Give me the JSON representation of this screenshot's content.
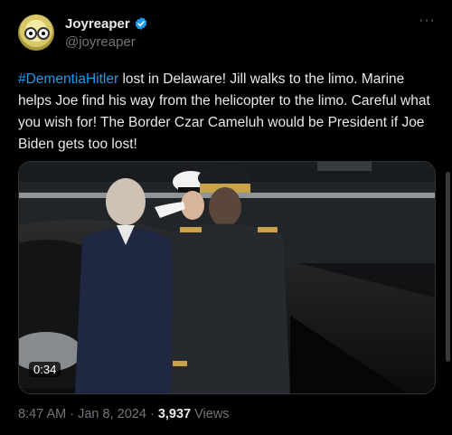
{
  "author": {
    "name": "Joyreaper",
    "handle": "@joyreaper",
    "verified_icon": "verified-badge-icon",
    "accent_color": "#1d9bf0"
  },
  "more_menu": {
    "icon": "more-horizontal-icon",
    "label": "···"
  },
  "post": {
    "hashtag": "#DementiaHitler",
    "text": " lost in Delaware! Jill walks to the limo. Marine helps Joe find his way from the helicopter to the limo. Careful what you wish for!  The Border Czar Cameluh would be President if Joe Biden gets too lost!"
  },
  "media": {
    "type": "video",
    "duration": "0:34"
  },
  "meta": {
    "time": "8:47 AM",
    "separator": "·",
    "date": "Jan 8, 2024",
    "views_count": "3,937",
    "views_label": "Views"
  }
}
